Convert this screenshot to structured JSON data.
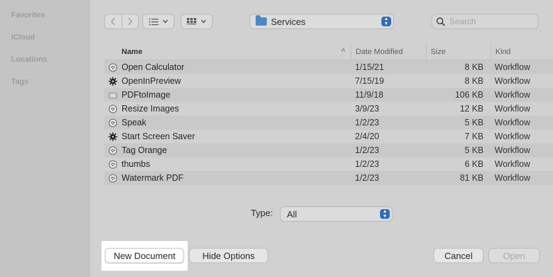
{
  "sidebar": {
    "sections": [
      "Favorites",
      "iCloud",
      "Locations",
      "Tags"
    ]
  },
  "toolbar": {
    "back_icon": "chevron-left",
    "forward_icon": "chevron-right",
    "list_view_icon": "list",
    "grid_view_icon": "grid",
    "location": "Services",
    "search_placeholder": "Search"
  },
  "table": {
    "columns": {
      "name": "Name",
      "date": "Date Modified",
      "size": "Size",
      "kind": "Kind"
    },
    "rows": [
      {
        "name": "Open Calculator",
        "date": "1/15/21",
        "size": "8 KB",
        "kind": "Workflow",
        "icon": "workflow"
      },
      {
        "name": "OpenInPreview",
        "date": "7/15/19",
        "size": "8 KB",
        "kind": "Workflow",
        "icon": "gear"
      },
      {
        "name": "PDFtoImage",
        "date": "11/9/18",
        "size": "106 KB",
        "kind": "Workflow",
        "icon": "image"
      },
      {
        "name": "Resize Images",
        "date": "3/9/23",
        "size": "12 KB",
        "kind": "Workflow",
        "icon": "workflow"
      },
      {
        "name": "Speak",
        "date": "1/2/23",
        "size": "5 KB",
        "kind": "Workflow",
        "icon": "workflow"
      },
      {
        "name": "Start Screen Saver",
        "date": "2/4/20",
        "size": "7 KB",
        "kind": "Workflow",
        "icon": "gear"
      },
      {
        "name": "Tag Orange",
        "date": "1/2/23",
        "size": "5 KB",
        "kind": "Workflow",
        "icon": "workflow"
      },
      {
        "name": "thumbs",
        "date": "1/2/23",
        "size": "6 KB",
        "kind": "Workflow",
        "icon": "workflow"
      },
      {
        "name": "Watermark PDF",
        "date": "1/2/23",
        "size": "81 KB",
        "kind": "Workflow",
        "icon": "workflow"
      }
    ]
  },
  "type_filter": {
    "label": "Type:",
    "value": "All"
  },
  "buttons": {
    "new_document": "New Document",
    "hide_options": "Hide Options",
    "cancel": "Cancel",
    "open": "Open"
  },
  "colors": {
    "accent": "#2f6bc1",
    "folder": "#4a89c8"
  }
}
